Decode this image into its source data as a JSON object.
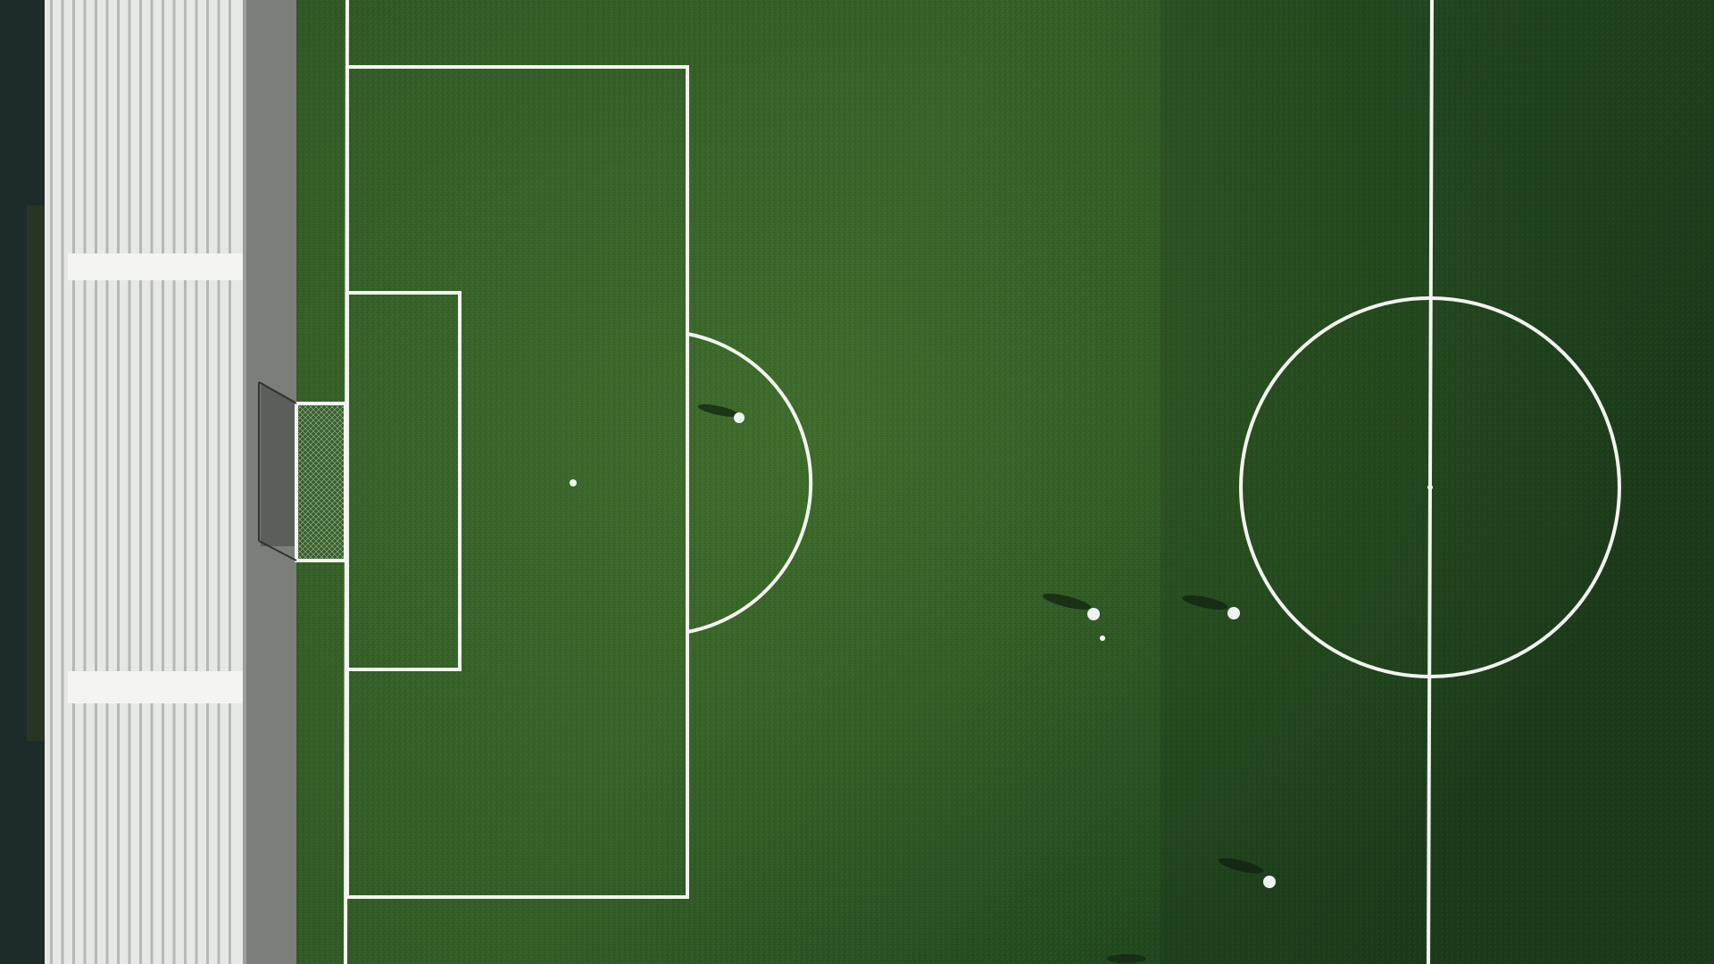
{
  "scene": {
    "subject": "aerial-view-of-soccer-pitch",
    "colors": {
      "grass_light": "#3f6b2b",
      "grass_mid": "#2f5424",
      "grass_dark": "#1c3a1c",
      "line": "#f2f4ef",
      "track": "#7b7e79",
      "bleacher": "#e9ebe8",
      "bleacher_shadow": "#8d918c",
      "edge_dark": "#1d2b2a",
      "player": "#eef2f0",
      "shadow": "#0f200f"
    },
    "players_count": 5,
    "ball_visible": true
  }
}
